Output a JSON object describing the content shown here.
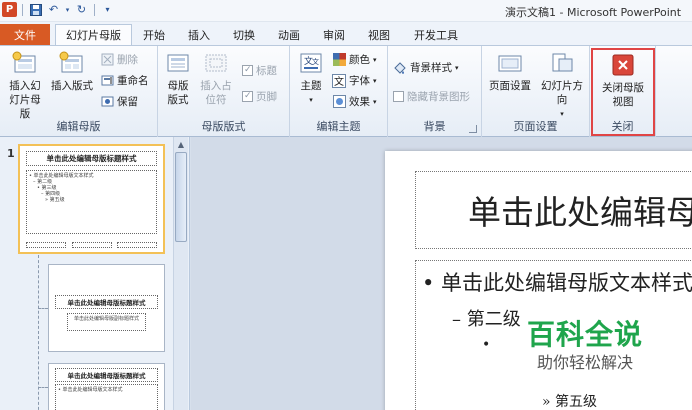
{
  "titlebar": {
    "app_logo_text": "P",
    "window_title": "演示文稿1 - Microsoft PowerPoint"
  },
  "tabs": [
    {
      "label": "文件"
    },
    {
      "label": "幻灯片母版"
    },
    {
      "label": "开始"
    },
    {
      "label": "插入"
    },
    {
      "label": "切换"
    },
    {
      "label": "动画"
    },
    {
      "label": "审阅"
    },
    {
      "label": "视图"
    },
    {
      "label": "开发工具"
    }
  ],
  "ribbon": {
    "edit_master": {
      "label": "编辑母版",
      "insert_slide_master": "插入幻灯片母版",
      "insert_layout": "插入版式",
      "delete": "删除",
      "rename": "重命名",
      "preserve": "保留"
    },
    "master_layout": {
      "label": "母版版式",
      "master_layout_btn": "母版版式",
      "insert_placeholder": "插入占位符",
      "title_chk": "标题",
      "footer_chk": "页脚"
    },
    "edit_theme": {
      "label": "编辑主题",
      "themes": "主题",
      "colors": "颜色",
      "fonts": "字体",
      "effects": "效果"
    },
    "background": {
      "label": "背景",
      "bg_styles": "背景样式",
      "hide_bg": "隐藏背景图形"
    },
    "page_setup": {
      "label": "页面设置",
      "page_setup_btn": "页面设置",
      "orientation": "幻灯片方向"
    },
    "close": {
      "label": "关闭",
      "close_master": "关闭母版视图"
    }
  },
  "thumbnails": {
    "slide_number": "1",
    "master_title": "单击此处编辑母版标题样式",
    "master_body_l1": "• 单击此处编辑母版文本样式",
    "master_body_l2": "– 第二级",
    "master_body_l3": "• 第三级",
    "master_body_l4": "– 第四级",
    "master_body_l5": "» 第五级",
    "layout1_title": "单击此处编辑母版标题样式",
    "layout1_sub": "单击此处编辑母版副标题样式",
    "layout2_title": "单击此处编辑母版标题样式",
    "layout2_body": "• 单击此处编辑母版文本样式"
  },
  "slide": {
    "title": "单击此处编辑母版标题样式",
    "bullet1": "• 单击此处编辑母版文本样式",
    "bullet2": "– 第二级",
    "bullet3": "•",
    "bullet5": "» 第五级"
  },
  "watermark": {
    "main": "百科全说",
    "sub": "助你轻松解决"
  },
  "colors": {
    "file_tab": "#d85a24",
    "close_highlight": "#e04545",
    "watermark_green": "#1fa54c"
  }
}
